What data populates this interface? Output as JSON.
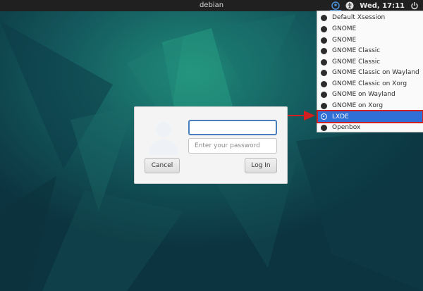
{
  "topbar": {
    "hostname": "debian",
    "clock": "Wed, 17:11"
  },
  "session_menu": {
    "items": [
      {
        "label": "Default Xsession",
        "selected": false
      },
      {
        "label": "GNOME",
        "selected": false
      },
      {
        "label": "GNOME",
        "selected": false
      },
      {
        "label": "GNOME Classic",
        "selected": false
      },
      {
        "label": "GNOME Classic",
        "selected": false
      },
      {
        "label": "GNOME Classic on Wayland",
        "selected": false
      },
      {
        "label": "GNOME Classic on Xorg",
        "selected": false
      },
      {
        "label": "GNOME on Wayland",
        "selected": false
      },
      {
        "label": "GNOME on Xorg",
        "selected": false
      },
      {
        "label": "LXDE",
        "selected": true
      },
      {
        "label": "Openbox",
        "selected": false
      }
    ]
  },
  "login": {
    "username_value": "",
    "password_placeholder": "Enter your password",
    "cancel_label": "Cancel",
    "login_label": "Log In"
  },
  "icons": {
    "session": "session-icon",
    "accessibility": "accessibility-icon",
    "power": "power-icon",
    "avatar": "user-avatar-icon"
  },
  "colors": {
    "selection": "#2f6fd6",
    "highlight_border": "#d21f1f",
    "annotation_arrow": "#d21f1f",
    "topbar": "#202020"
  }
}
